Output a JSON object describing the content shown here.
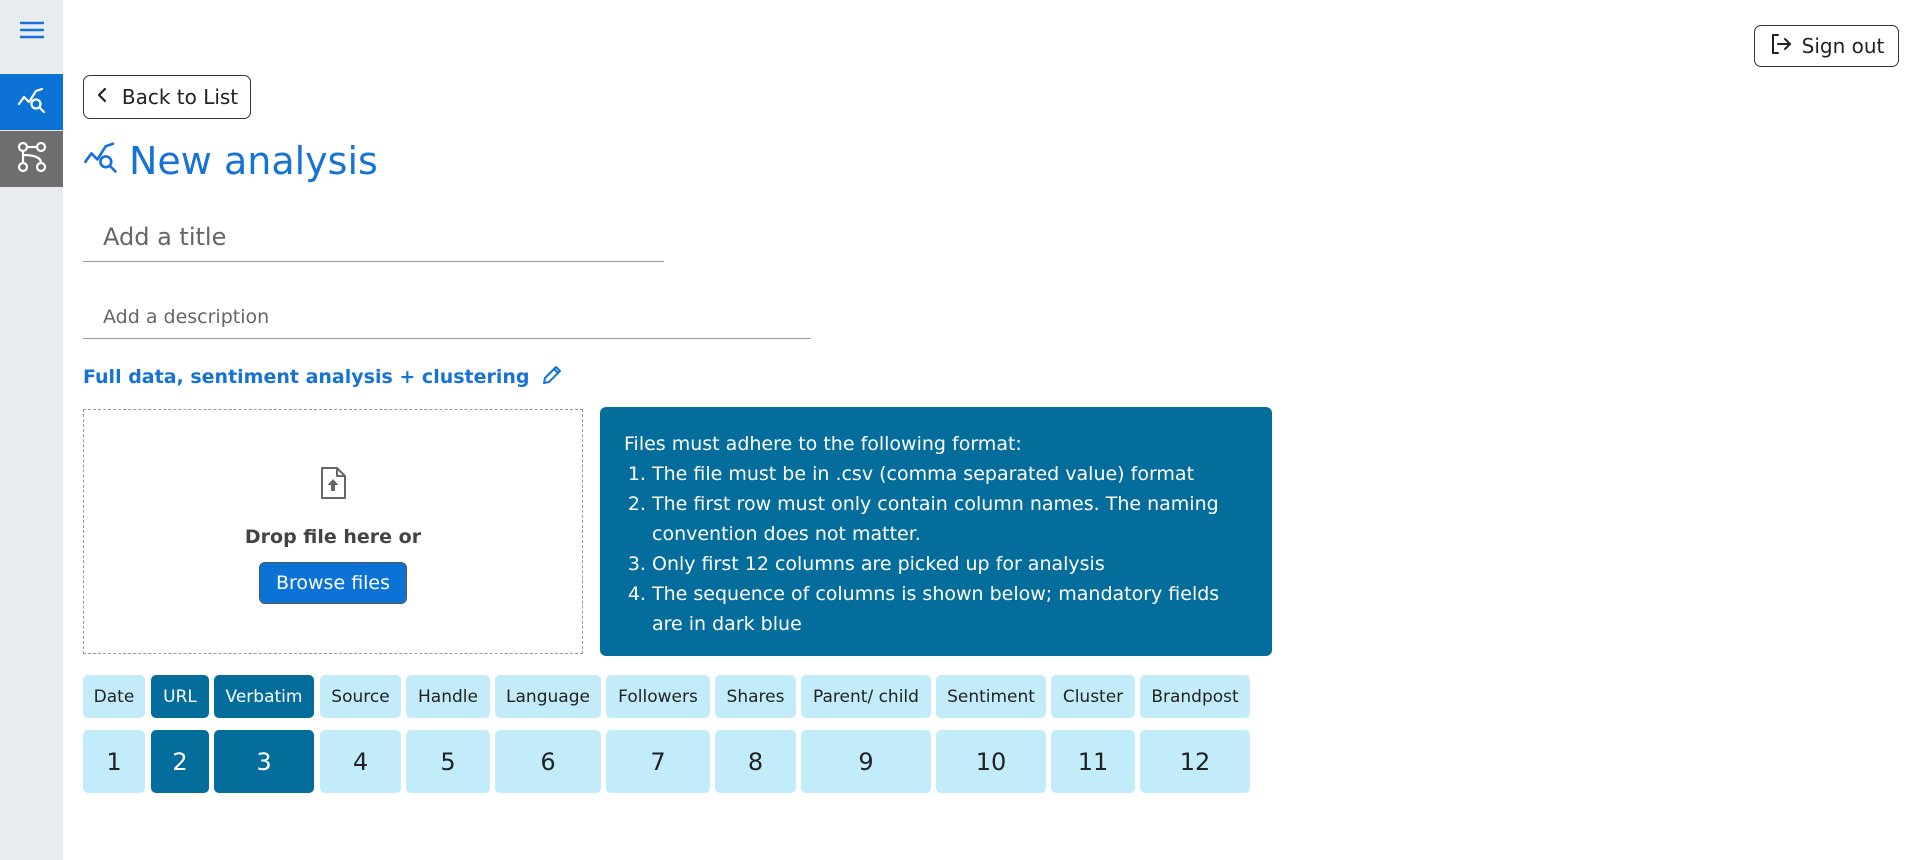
{
  "sidebar": {
    "menu_icon": "hamburger-menu-icon",
    "items": [
      {
        "name": "analysis",
        "icon": "chart-search-icon",
        "active": true
      },
      {
        "name": "flow",
        "icon": "workflow-nodes-icon",
        "active": false
      }
    ]
  },
  "header": {
    "signout_label": "Sign out",
    "back_label": "Back to List"
  },
  "page": {
    "title": "New analysis",
    "title_placeholder": "Add a title",
    "description_placeholder": "Add a description",
    "analysis_type": "Full data, sentiment analysis + clustering"
  },
  "upload": {
    "drop_text": "Drop file here or",
    "browse_label": "Browse files"
  },
  "info": {
    "heading": "Files must adhere to the following format:",
    "items": [
      "The file must be in .csv (comma separated value) format",
      "The first row must only contain column names. The naming convention does not matter.",
      "Only first 12 columns are picked up for analysis",
      "The sequence of columns is shown below; mandatory fields are in dark blue"
    ]
  },
  "columns": [
    {
      "name": "Date",
      "number": "1",
      "mandatory": false
    },
    {
      "name": "URL",
      "number": "2",
      "mandatory": true
    },
    {
      "name": "Verbatim",
      "number": "3",
      "mandatory": true
    },
    {
      "name": "Source",
      "number": "4",
      "mandatory": false
    },
    {
      "name": "Handle",
      "number": "5",
      "mandatory": false
    },
    {
      "name": "Language",
      "number": "6",
      "mandatory": false
    },
    {
      "name": "Followers",
      "number": "7",
      "mandatory": false
    },
    {
      "name": "Shares",
      "number": "8",
      "mandatory": false
    },
    {
      "name": "Parent/ child",
      "number": "9",
      "mandatory": false
    },
    {
      "name": "Sentiment",
      "number": "10",
      "mandatory": false
    },
    {
      "name": "Cluster",
      "number": "11",
      "mandatory": false
    },
    {
      "name": "Brandpost",
      "number": "12",
      "mandatory": false
    }
  ],
  "colors": {
    "accent": "#0b72d6",
    "mandatory": "#046d9b",
    "optional": "#c3ecfa"
  }
}
